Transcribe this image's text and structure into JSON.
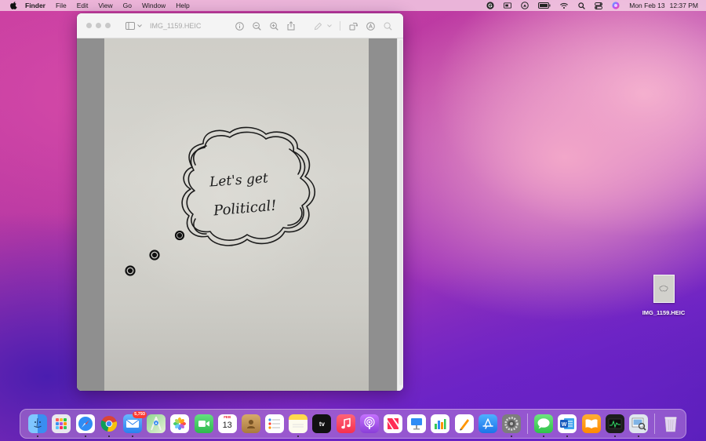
{
  "menubar": {
    "app_name": "Finder",
    "items": [
      "File",
      "Edit",
      "View",
      "Go",
      "Window",
      "Help"
    ],
    "clock": {
      "date": "Mon Feb 13",
      "time": "12:37 PM"
    },
    "status_icons": [
      "grammarly-icon",
      "screen-mirror-icon",
      "airplay-icon",
      "battery-icon",
      "wifi-icon",
      "spotlight-search-icon",
      "control-center-icon",
      "siri-icon"
    ]
  },
  "window": {
    "title": "IMG_1159.HEIC",
    "toolbar_icons": [
      "info-icon",
      "zoom-out-icon",
      "zoom-in-icon",
      "share-icon",
      "markup-pen-icon",
      "rotate-icon",
      "annotate-icon",
      "search-icon"
    ],
    "photo_text": {
      "line1": "Let's get",
      "line2": "Political!"
    }
  },
  "desktop": {
    "file_label": "IMG_1159.HEIC"
  },
  "dock": {
    "apps": [
      {
        "name": "finder",
        "color": "#3a8ef0",
        "running": true
      },
      {
        "name": "launchpad",
        "color": "#e7e7ee",
        "running": false
      },
      {
        "name": "safari",
        "color": "#2f8cf5",
        "running": true
      },
      {
        "name": "chrome",
        "color": "#ffffff",
        "running": true
      },
      {
        "name": "mail",
        "color": "#3d9bf5",
        "running": true,
        "badge": "5,793"
      },
      {
        "name": "maps",
        "color": "#6cc36c",
        "running": false
      },
      {
        "name": "photos",
        "color": "#ffffff",
        "running": false
      },
      {
        "name": "facetime",
        "color": "#34c759",
        "running": false
      },
      {
        "name": "calendar",
        "color": "#ffffff",
        "running": false,
        "month": "FEB",
        "day": "13"
      },
      {
        "name": "contacts",
        "color": "#c79a5a",
        "running": false
      },
      {
        "name": "reminders",
        "color": "#ffffff",
        "running": false
      },
      {
        "name": "notes",
        "color": "#ffd84d",
        "running": true
      },
      {
        "name": "tv",
        "color": "#111111",
        "running": false,
        "label": "tv"
      },
      {
        "name": "music",
        "color": "#fa3c52",
        "running": false
      },
      {
        "name": "podcasts",
        "color": "#9b4de0",
        "running": false
      },
      {
        "name": "news",
        "color": "#ffffff",
        "running": false
      },
      {
        "name": "keynote",
        "color": "#ffffff",
        "running": false
      },
      {
        "name": "numbers",
        "color": "#ffffff",
        "running": false
      },
      {
        "name": "pages",
        "color": "#ffffff",
        "running": false
      },
      {
        "name": "app-store",
        "color": "#2b8ef2",
        "running": false
      },
      {
        "name": "system-preferences",
        "color": "#8a8a8a",
        "running": true
      },
      {
        "name": "messages",
        "color": "#4cd964",
        "running": true
      },
      {
        "name": "word",
        "color": "#ffffff",
        "running": true
      },
      {
        "name": "books",
        "color": "#ff9500",
        "running": false
      },
      {
        "name": "activity-monitor",
        "color": "#1d1d1d",
        "running": true
      },
      {
        "name": "preview",
        "color": "#e9eef3",
        "running": true
      },
      {
        "name": "trash",
        "color": "transparent",
        "running": false
      }
    ]
  }
}
